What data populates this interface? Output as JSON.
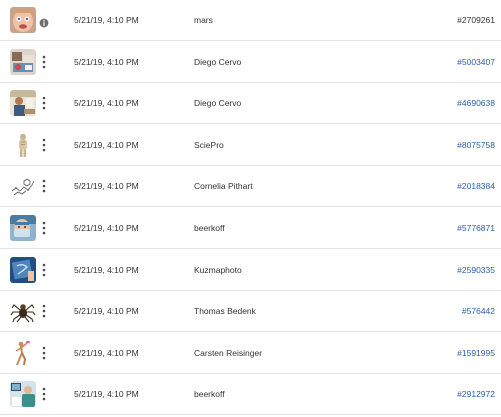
{
  "colors": {
    "link": "#2c5fa8",
    "text": "#333333",
    "divider": "#e4e4e4"
  },
  "rows": [
    {
      "thumbnail": "face-portrait-thumbnail",
      "action_icon": "info-icon",
      "date": "5/21/19, 4:10 PM",
      "author": "mars",
      "id": "#2709261",
      "id_is_link": false
    },
    {
      "thumbnail": "desk-workspace-thumbnail",
      "action_icon": "more-vertical-icon",
      "date": "5/21/19, 4:10 PM",
      "author": "Diego Cervo",
      "id": "#5003407",
      "id_is_link": true
    },
    {
      "thumbnail": "office-people-thumbnail",
      "action_icon": "more-vertical-icon",
      "date": "5/21/19, 4:10 PM",
      "author": "Diego Cervo",
      "id": "#4690638",
      "id_is_link": true
    },
    {
      "thumbnail": "anatomy-figure-thumbnail",
      "action_icon": "more-vertical-icon",
      "date": "5/21/19, 4:10 PM",
      "author": "SciePro",
      "id": "#8075758",
      "id_is_link": true
    },
    {
      "thumbnail": "molecule-sketch-thumbnail",
      "action_icon": "more-vertical-icon",
      "date": "5/21/19, 4:10 PM",
      "author": "Cornelia Pithart",
      "id": "#2018384",
      "id_is_link": true
    },
    {
      "thumbnail": "masked-surgeon-thumbnail",
      "action_icon": "more-vertical-icon",
      "date": "5/21/19, 4:10 PM",
      "author": "beerkoff",
      "id": "#5776871",
      "id_is_link": true
    },
    {
      "thumbnail": "xray-scan-thumbnail",
      "action_icon": "more-vertical-icon",
      "date": "5/21/19, 4:10 PM",
      "author": "Kuzmaphoto",
      "id": "#2590335",
      "id_is_link": true
    },
    {
      "thumbnail": "spider-thumbnail",
      "action_icon": "more-vertical-icon",
      "date": "5/21/19, 4:10 PM",
      "author": "Thomas Bedenk",
      "id": "#576442",
      "id_is_link": true
    },
    {
      "thumbnail": "gymnast-figure-thumbnail",
      "action_icon": "more-vertical-icon",
      "date": "5/21/19, 4:10 PM",
      "author": "Carsten Reisinger",
      "id": "#1591995",
      "id_is_link": true
    },
    {
      "thumbnail": "medical-exam-thumbnail",
      "action_icon": "more-vertical-icon",
      "date": "5/21/19, 4:10 PM",
      "author": "beerkoff",
      "id": "#2912972",
      "id_is_link": true
    }
  ]
}
